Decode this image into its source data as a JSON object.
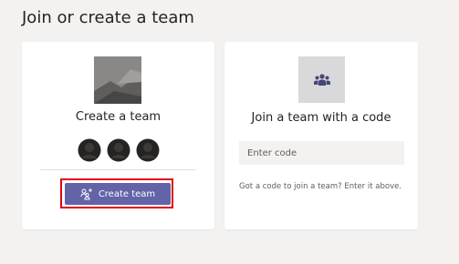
{
  "page": {
    "title": "Join or create a team"
  },
  "create_card": {
    "title": "Create a team",
    "button_label": "Create team",
    "button_icon": "add-team-icon",
    "thumbnail_icon": "team-placeholder-image",
    "avatar_icon": "person-avatar-icon",
    "highlight_color": "#e3000f"
  },
  "join_card": {
    "title": "Join a team with a code",
    "icon": "teams-icon",
    "input": {
      "placeholder": "Enter code",
      "value": ""
    },
    "hint": "Got a code to join a team? Enter it above."
  },
  "colors": {
    "brand": "#6264a7",
    "background": "#f3f2f1",
    "card": "#ffffff"
  }
}
